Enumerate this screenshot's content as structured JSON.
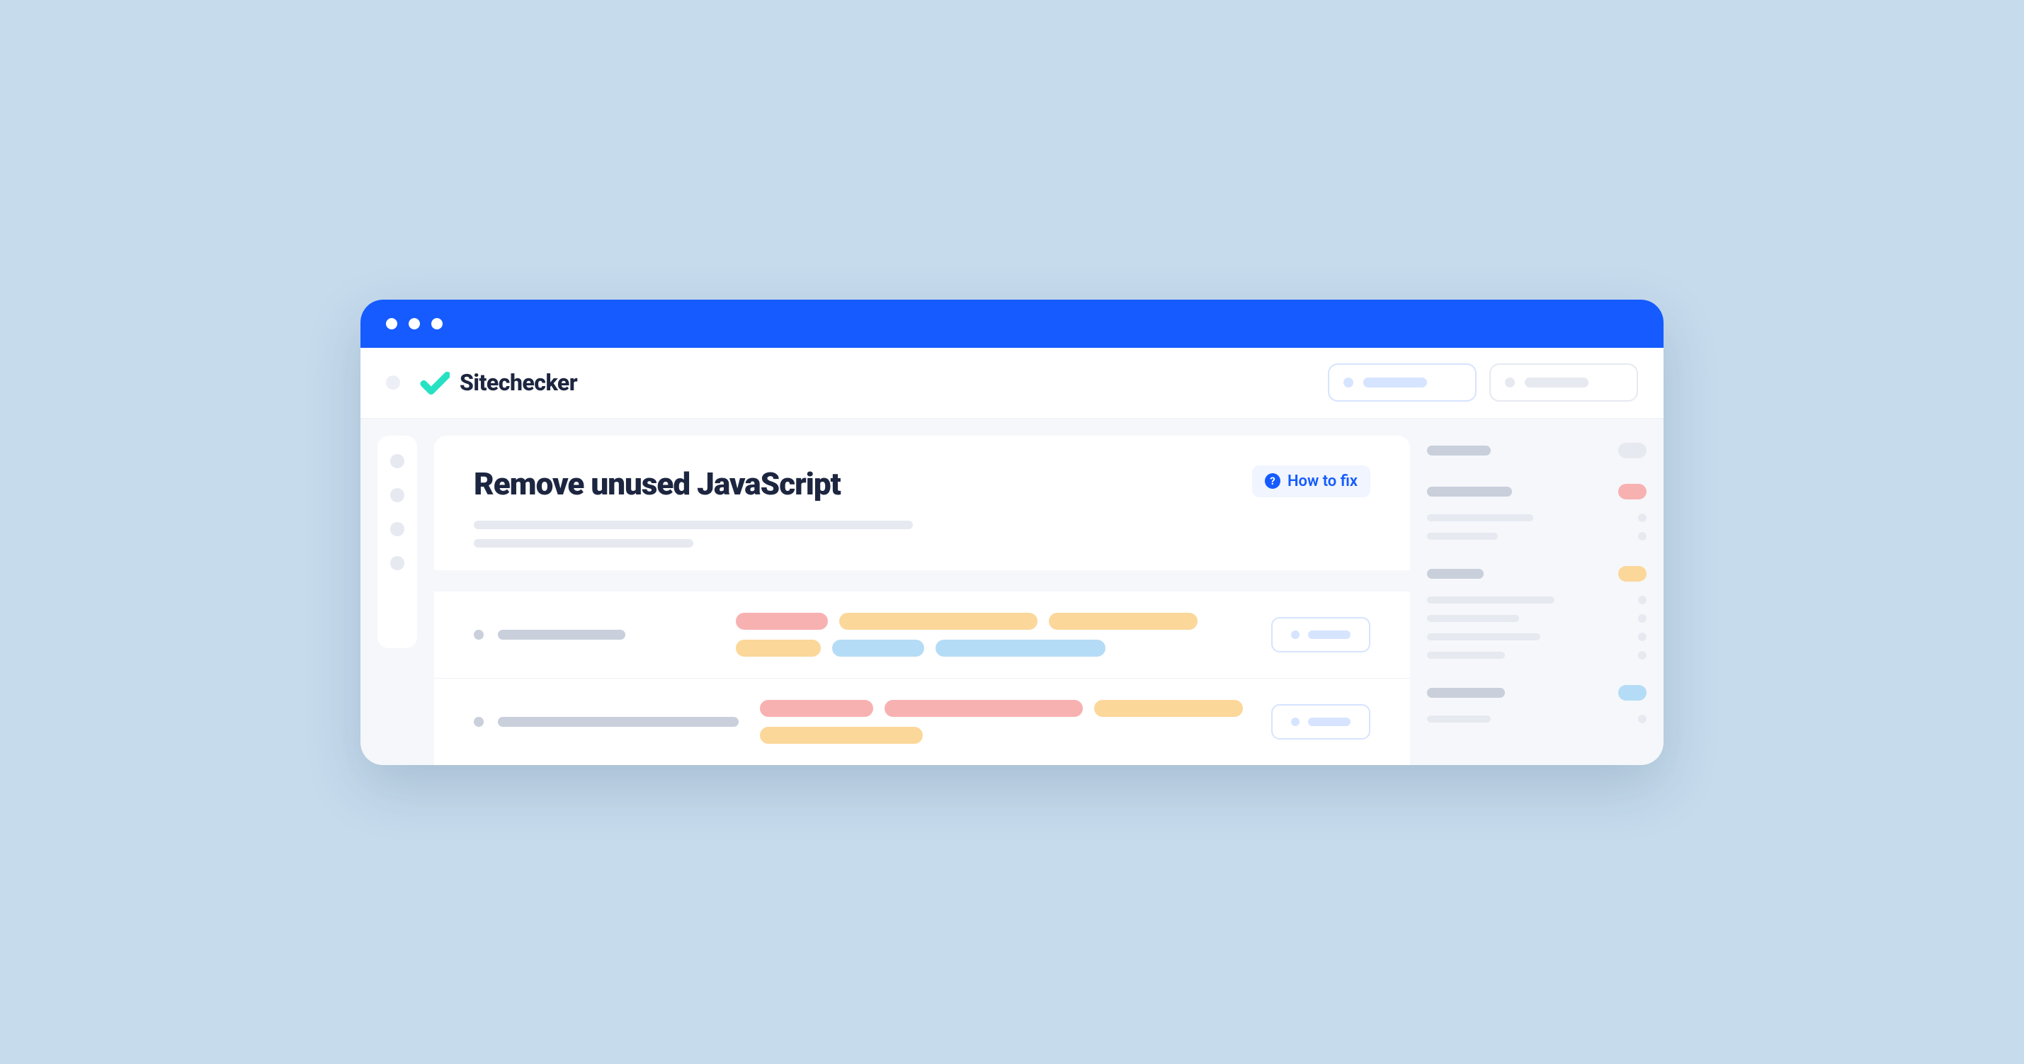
{
  "brand": "Sitechecker",
  "page_title": "Remove unused JavaScript",
  "howto_label": "How to fix"
}
